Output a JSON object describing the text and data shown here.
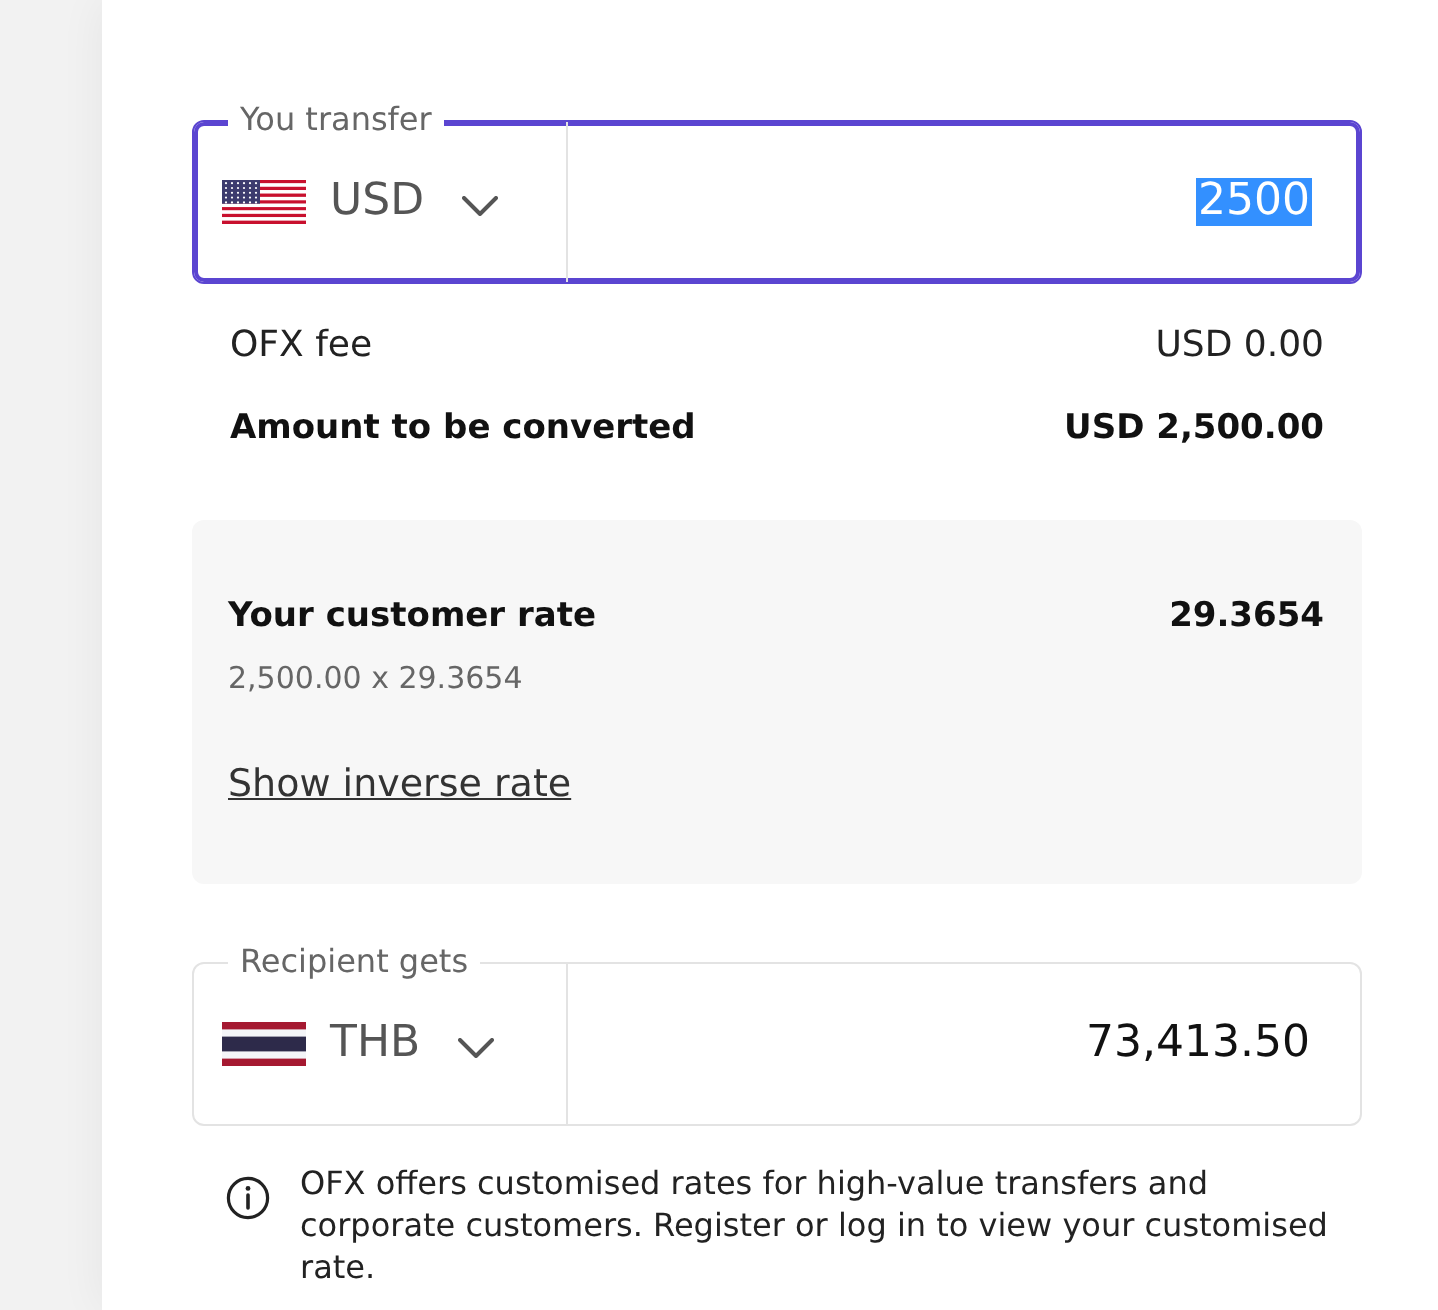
{
  "send_field": {
    "legend": "You transfer",
    "currency": "USD",
    "amount": "2500",
    "focused": true,
    "text_selected": true
  },
  "summary_rows": [
    {
      "label": "OFX fee",
      "value": "USD 0.00",
      "kind": "plain"
    },
    {
      "label": "Amount to be converted",
      "value": "USD 2,500.00",
      "kind": "total"
    }
  ],
  "rate_panel": {
    "title": "Your customer rate",
    "rate": "29.3654",
    "formula": "2,500.00 x 29.3654",
    "link": "Show inverse rate"
  },
  "receive_field": {
    "legend": "Recipient gets",
    "currency": "THB",
    "amount": "73,413.50",
    "focused": false,
    "text_selected": false
  },
  "notice": {
    "text": "OFX offers customised rates for high-value transfers and corporate customers. Register or log in to view your customised rate."
  }
}
